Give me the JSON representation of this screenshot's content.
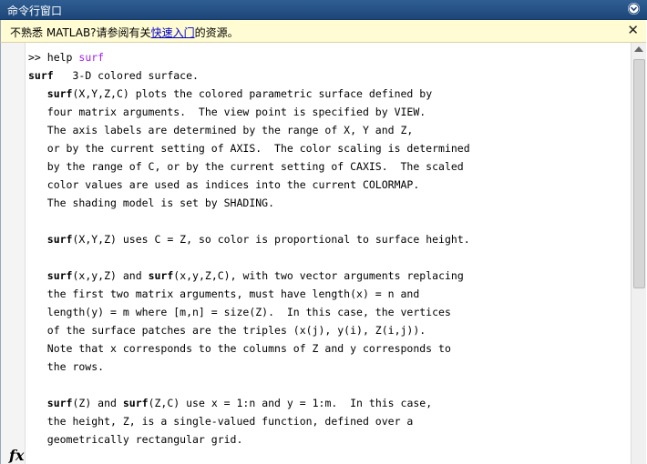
{
  "window": {
    "title": "命令行窗口",
    "menu_icon": "chevron-down-circle-icon"
  },
  "infobar": {
    "prefix": "不熟悉 MATLAB?请参阅有关",
    "link": "快速入门",
    "suffix": "的资源。",
    "close_label": "✕"
  },
  "prompt_symbol": "fx",
  "console": {
    "lines": [
      [
        {
          "t": ">> help ",
          "s": ""
        },
        {
          "t": "surf",
          "s": "arg"
        }
      ],
      [
        {
          "t": "surf",
          "s": "kw"
        },
        {
          "t": "   3-D colored surface.",
          "s": ""
        }
      ],
      [
        {
          "t": "   ",
          "s": ""
        },
        {
          "t": "surf",
          "s": "kw"
        },
        {
          "t": "(X,Y,Z,C) plots the colored parametric surface defined by",
          "s": ""
        }
      ],
      [
        {
          "t": "   four matrix arguments.  The view point is specified by VIEW.",
          "s": ""
        }
      ],
      [
        {
          "t": "   The axis labels are determined by the range of X, Y and Z,",
          "s": ""
        }
      ],
      [
        {
          "t": "   or by the current setting of AXIS.  The color scaling is determined",
          "s": ""
        }
      ],
      [
        {
          "t": "   by the range of C, or by the current setting of CAXIS.  The scaled",
          "s": ""
        }
      ],
      [
        {
          "t": "   color values are used as indices into the current COLORMAP.",
          "s": ""
        }
      ],
      [
        {
          "t": "   The shading model is set by SHADING.",
          "s": ""
        }
      ],
      [
        {
          "t": "",
          "s": ""
        }
      ],
      [
        {
          "t": "   ",
          "s": ""
        },
        {
          "t": "surf",
          "s": "kw"
        },
        {
          "t": "(X,Y,Z) uses C = Z, so color is proportional to surface height.",
          "s": ""
        }
      ],
      [
        {
          "t": "",
          "s": ""
        }
      ],
      [
        {
          "t": "   ",
          "s": ""
        },
        {
          "t": "surf",
          "s": "kw"
        },
        {
          "t": "(x,y,Z) and ",
          "s": ""
        },
        {
          "t": "surf",
          "s": "kw"
        },
        {
          "t": "(x,y,Z,C), with two vector arguments replacing",
          "s": ""
        }
      ],
      [
        {
          "t": "   the first two matrix arguments, must have length(x) = n and",
          "s": ""
        }
      ],
      [
        {
          "t": "   length(y) = m where [m,n] = size(Z).  In this case, the vertices",
          "s": ""
        }
      ],
      [
        {
          "t": "   of the surface patches are the triples (x(j), y(i), Z(i,j)).",
          "s": ""
        }
      ],
      [
        {
          "t": "   Note that x corresponds to the columns of Z and y corresponds to",
          "s": ""
        }
      ],
      [
        {
          "t": "   the rows.",
          "s": ""
        }
      ],
      [
        {
          "t": "",
          "s": ""
        }
      ],
      [
        {
          "t": "   ",
          "s": ""
        },
        {
          "t": "surf",
          "s": "kw"
        },
        {
          "t": "(Z) and ",
          "s": ""
        },
        {
          "t": "surf",
          "s": "kw"
        },
        {
          "t": "(Z,C) use x = 1:n and y = 1:m.  In this case,",
          "s": ""
        }
      ],
      [
        {
          "t": "   the height, Z, is a single-valued function, defined over a",
          "s": ""
        }
      ],
      [
        {
          "t": "   geometrically rectangular grid.",
          "s": ""
        }
      ]
    ]
  }
}
